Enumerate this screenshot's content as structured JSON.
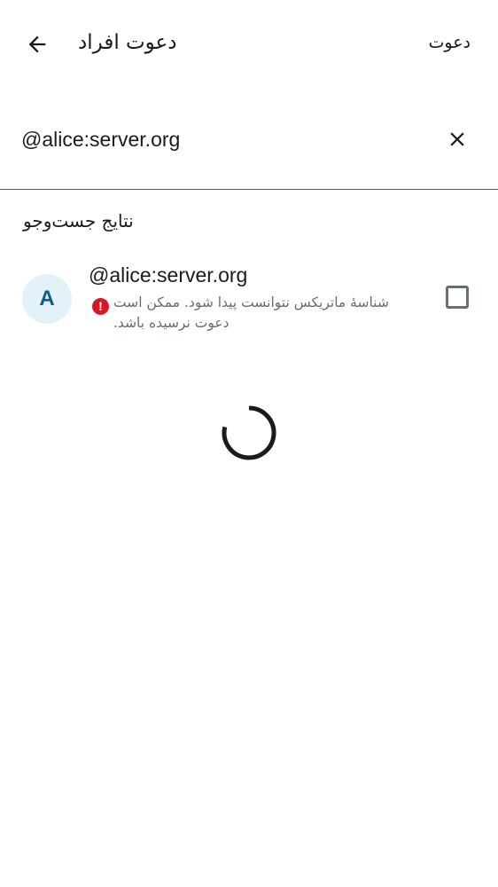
{
  "header": {
    "title": "دعوت افراد",
    "invite_label": "دعوت",
    "back_icon": "arrow-left-icon"
  },
  "search": {
    "value": "@alice:server.org",
    "clear_icon": "close-icon"
  },
  "results": {
    "section_title": "نتایج جست‌وجو",
    "items": [
      {
        "avatar_letter": "A",
        "name": "@alice:server.org",
        "error_text": "شناسهٔ ماتریکس نتوانست پیدا شود. ممکن است دعوت نرسیده باشد.",
        "checked": false
      }
    ]
  },
  "colors": {
    "avatar_bg": "#e3f2f8",
    "avatar_text": "#0b5f8a",
    "error": "#d51928",
    "secondary_text": "#656d77"
  }
}
